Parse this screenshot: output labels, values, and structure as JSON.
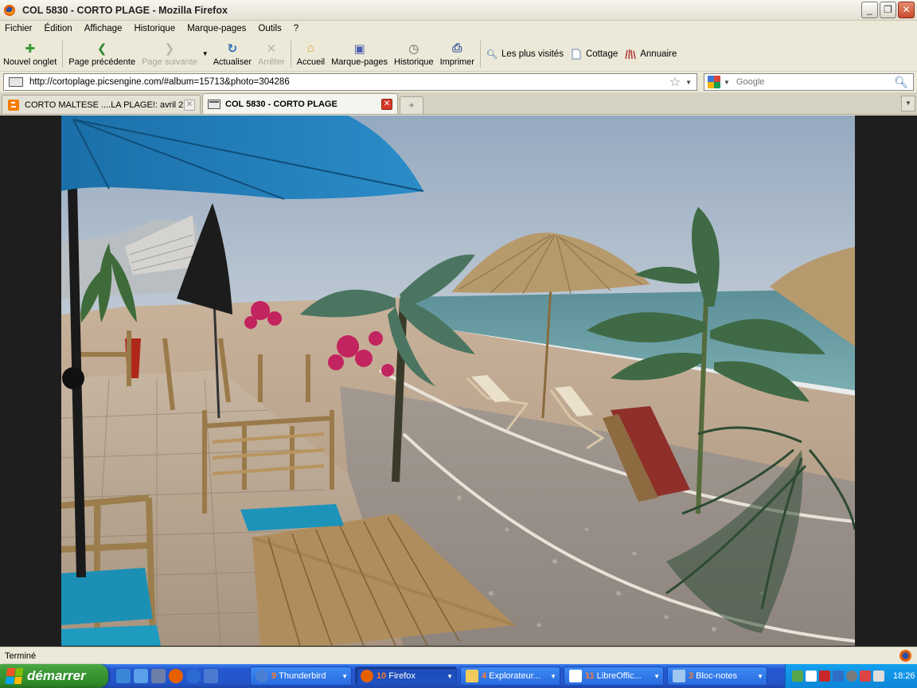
{
  "window": {
    "title": "COL 5830 - CORTO PLAGE - Mozilla Firefox",
    "minimize": "_",
    "maximize": "❐",
    "close": "✕"
  },
  "menu": [
    "Fichier",
    "Édition",
    "Affichage",
    "Historique",
    "Marque-pages",
    "Outils",
    "?"
  ],
  "toolbar": {
    "new_tab": "Nouvel onglet",
    "back": "Page précédente",
    "forward": "Page suivante",
    "reload": "Actualiser",
    "stop": "Arrêter",
    "home": "Accueil",
    "bookmarks": "Marque-pages",
    "history": "Historique",
    "print": "Imprimer"
  },
  "bookmarks_bar": [
    "Les plus visités",
    "Cottage",
    "Annuaire"
  ],
  "urlbar": {
    "url": "http://cortoplage.picsengine.com/#album=15713&photo=304286"
  },
  "search": {
    "placeholder": "Google"
  },
  "tabs": [
    {
      "label": "CORTO MALTESE ....LA PLAGE!: avril 2...",
      "active": false
    },
    {
      "label": "COL 5830 - CORTO PLAGE",
      "active": true
    }
  ],
  "new_tab_symbol": "+",
  "status": "Terminé",
  "taskbar": {
    "start": "démarrer",
    "tasks": [
      {
        "num": "9",
        "label": "Thunderbird",
        "active": false
      },
      {
        "num": "10",
        "label": "Firefox",
        "active": true
      },
      {
        "num": "4",
        "label": "Explorateur...",
        "active": false
      },
      {
        "num": "11",
        "label": "LibreOffic...",
        "active": false
      },
      {
        "num": "3",
        "label": "Bloc-notes",
        "active": false
      }
    ],
    "clock": "18:26"
  },
  "colors": {
    "accent": "#2455c9",
    "start_green": "#3b9a35",
    "tray_blue": "#0d86d9"
  }
}
